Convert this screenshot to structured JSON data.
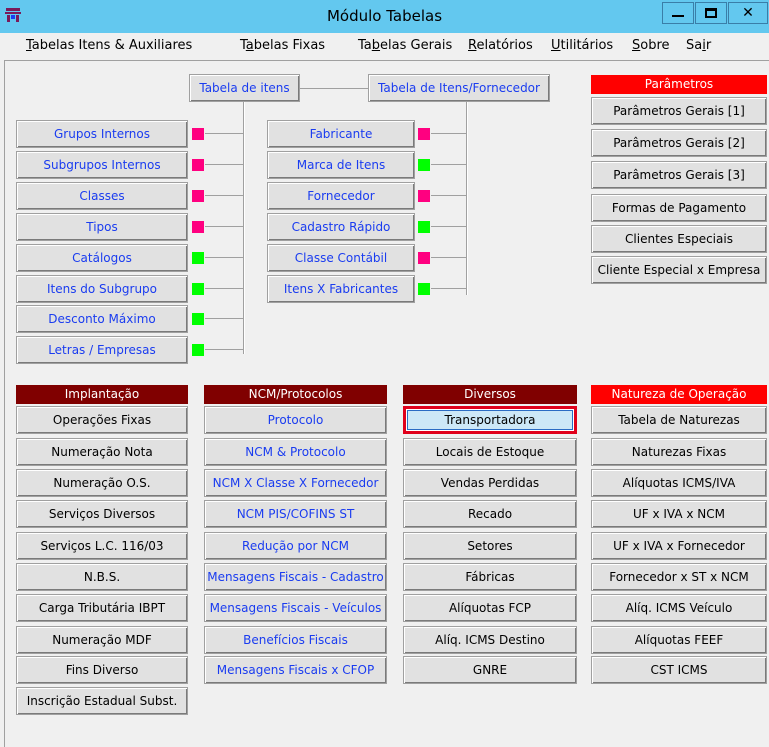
{
  "window": {
    "title": "Módulo Tabelas",
    "min": "—",
    "max": "☐",
    "close": "✕"
  },
  "menu": [
    {
      "pre": "",
      "u": "T",
      "post": "abelas Itens & Auxiliares"
    },
    {
      "pre": "T",
      "u": "a",
      "post": "belas Fixas"
    },
    {
      "pre": "Ta",
      "u": "b",
      "post": "elas Gerais"
    },
    {
      "pre": "",
      "u": "R",
      "post": "elatórios"
    },
    {
      "pre": "",
      "u": "U",
      "post": "tilitários"
    },
    {
      "pre": "",
      "u": "S",
      "post": "obre"
    },
    {
      "pre": "Sa",
      "u": "i",
      "post": "r"
    }
  ],
  "tabela_itens": {
    "label": "Tabela de itens",
    "items": [
      "Grupos Internos",
      "Subgrupos Internos",
      "Classes",
      "Tipos",
      "Catálogos",
      "Itens do Subgrupo",
      "Desconto Máximo",
      "Letras / Empresas"
    ],
    "flags": [
      "pink",
      "pink",
      "pink",
      "pink",
      "green",
      "green",
      "green",
      "green"
    ]
  },
  "tabela_fornecedor": {
    "label": "Tabela de Itens/Fornecedor",
    "items": [
      "Fabricante",
      "Marca de Itens",
      "Fornecedor",
      "Cadastro Rápido",
      "Classe Contábil",
      "Itens X Fabricantes"
    ],
    "flags": [
      "pink",
      "green",
      "pink",
      "green",
      "pink",
      "green"
    ]
  },
  "parametros": {
    "header": "Parâmetros",
    "items": [
      "Parâmetros Gerais [1]",
      "Parâmetros Gerais [2]",
      "Parâmetros Gerais [3]",
      "Formas de Pagamento",
      "Clientes Especiais",
      "Cliente Especial x Empresa"
    ]
  },
  "implantacao": {
    "header": "Implantação",
    "items": [
      "Operações Fixas",
      "Numeração Nota",
      "Numeração O.S.",
      "Serviços Diversos",
      "Serviços L.C. 116/03",
      "N.B.S.",
      "Carga Tributária IBPT",
      "Numeração MDF",
      "Fins Diverso",
      "Inscrição Estadual Subst."
    ]
  },
  "ncm": {
    "header": "NCM/Protocolos",
    "items": [
      "Protocolo",
      "NCM & Protocolo",
      "NCM X Classe X Fornecedor",
      "NCM PIS/COFINS ST",
      "Redução por NCM",
      "Mensagens Fiscais - Cadastro",
      "Mensagens Fiscais - Veículos",
      "Benefícios Fiscais",
      "Mensagens Fiscais x CFOP"
    ]
  },
  "diversos": {
    "header": "Diversos",
    "items": [
      "Transportadora",
      "Locais de Estoque",
      "Vendas Perdidas",
      "Recado",
      "Setores",
      "Fábricas",
      "Alíquotas FCP",
      "Alíq. ICMS Destino",
      "GNRE"
    ]
  },
  "natureza": {
    "header": "Natureza de Operação",
    "items": [
      "Tabela de Naturezas",
      "Naturezas Fixas",
      "Alíquotas ICMS/IVA",
      "UF x IVA x NCM",
      "UF x IVA x Fornecedor",
      "Fornecedor x ST x NCM",
      "Alíq. ICMS Veículo",
      "Alíquotas FEEF",
      "CST ICMS"
    ]
  },
  "colors": {
    "title_bar": "#63c8ef",
    "header_dark": "#800000",
    "header_red": "#ff0000",
    "flag_pink": "#ff0080",
    "flag_green": "#00ff00",
    "link_blue": "#1a3cf0",
    "selected_border": "#e0001b"
  }
}
